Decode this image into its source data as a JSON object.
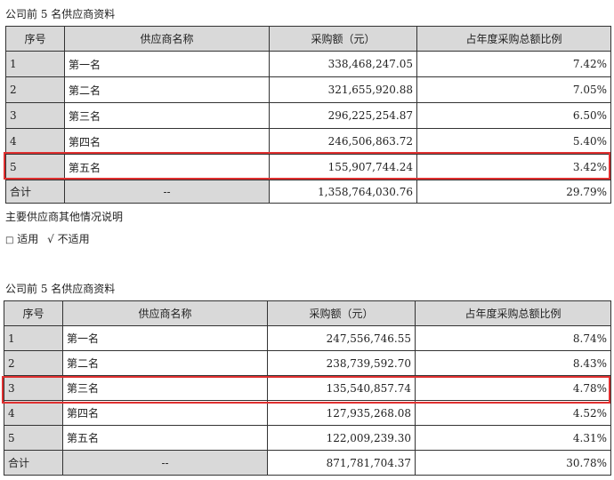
{
  "section1": {
    "caption": "公司前 5 名供应商资料",
    "headers": [
      "序号",
      "供应商名称",
      "采购额（元）",
      "占年度采购总额比例"
    ],
    "rows": [
      [
        "1",
        "第一名",
        "338,468,247.05",
        "7.42%"
      ],
      [
        "2",
        "第二名",
        "321,655,920.88",
        "7.05%"
      ],
      [
        "3",
        "第三名",
        "296,225,254.87",
        "6.50%"
      ],
      [
        "4",
        "第四名",
        "246,506,863.72",
        "5.40%"
      ],
      [
        "5",
        "第五名",
        "155,907,744.24",
        "3.42%"
      ]
    ],
    "total": [
      "合计",
      "--",
      "1,358,764,030.76",
      "29.79%"
    ]
  },
  "notes": {
    "title": "主要供应商其他情况说明",
    "option_a": "适用",
    "option_b": "不适用",
    "box_glyph": "□",
    "check_glyph": "√"
  },
  "section2": {
    "caption": "公司前 5 名供应商资料",
    "headers": [
      "序号",
      "供应商名称",
      "采购额（元）",
      "占年度采购总额比例"
    ],
    "rows": [
      [
        "1",
        "第一名",
        "247,556,746.55",
        "8.74%"
      ],
      [
        "2",
        "第二名",
        "238,739,592.70",
        "8.43%"
      ],
      [
        "3",
        "第三名",
        "135,540,857.74",
        "4.78%"
      ],
      [
        "4",
        "第四名",
        "127,935,268.08",
        "4.52%"
      ],
      [
        "5",
        "第五名",
        "122,009,239.30",
        "4.31%"
      ]
    ],
    "total": [
      "合计",
      "--",
      "871,781,704.37",
      "30.78%"
    ]
  },
  "colors": {
    "highlight": "#e03030",
    "header_bg": "#d9d9d9"
  }
}
